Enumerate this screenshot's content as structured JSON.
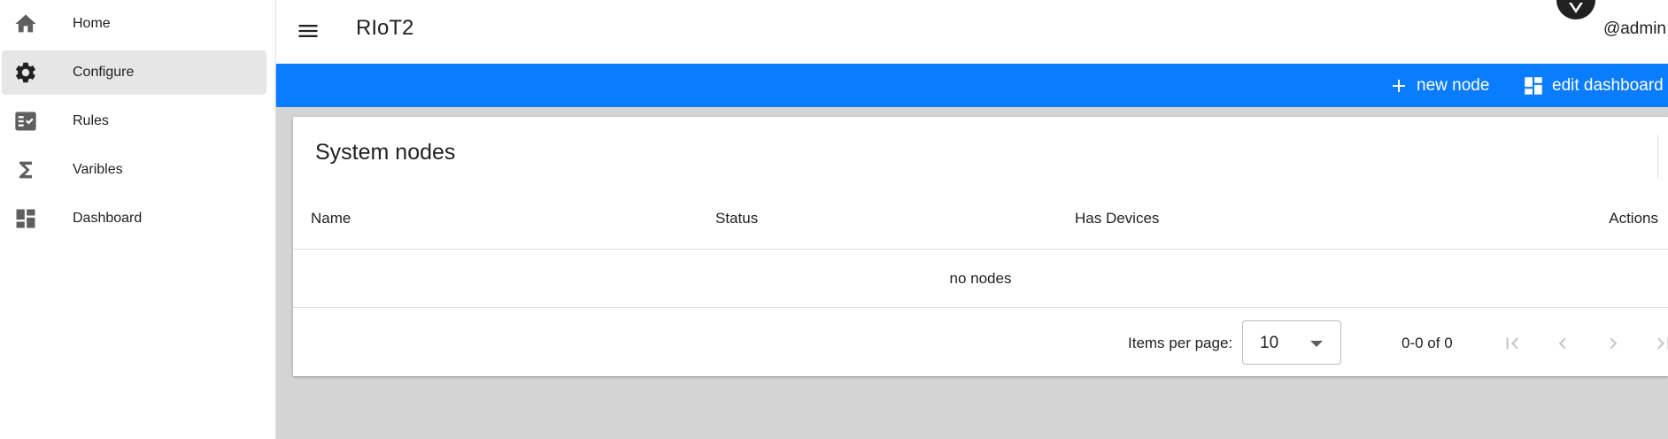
{
  "sidebar": {
    "items": [
      {
        "label": "Home",
        "icon": "home-icon"
      },
      {
        "label": "Configure",
        "icon": "gear-icon",
        "active": true
      },
      {
        "label": "Rules",
        "icon": "rules-icon"
      },
      {
        "label": "Varibles",
        "icon": "sigma-icon"
      },
      {
        "label": "Dashboard",
        "icon": "dashboard-icon"
      }
    ]
  },
  "header": {
    "title": "RIoT2",
    "user": "@admin"
  },
  "toolbar": {
    "new_node_label": "new node",
    "edit_dashboard_label": "edit dashboard"
  },
  "card": {
    "title": "System nodes",
    "columns": [
      "Name",
      "Status",
      "Has Devices",
      "Actions"
    ],
    "empty_message": "no nodes"
  },
  "pagination": {
    "items_per_page_label": "Items per page:",
    "items_per_page_value": "10",
    "range_label": "0-0 of 0"
  },
  "colors": {
    "accent": "#0a7cff",
    "background": "#d4d4d4",
    "active_nav": "#e6e6e6"
  }
}
